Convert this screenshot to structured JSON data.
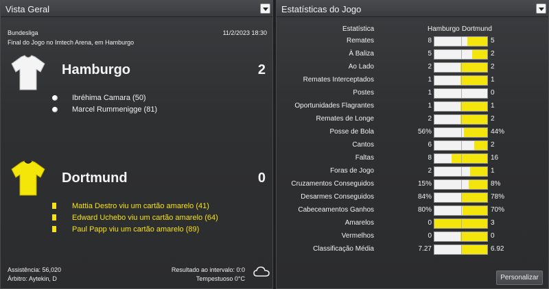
{
  "left_panel": {
    "title": "Vista Geral",
    "competition": "Bundesliga",
    "datetime": "11/2/2023 18:30",
    "venue": "Final do Jogo no Imtech Arena, em Hamburgo",
    "home": {
      "name": "Hamburgo",
      "score": "2",
      "shirt_color": "#f4f4f4",
      "events": [
        {
          "icon": "ball-icon",
          "text": "Ibréhima Camara (50)"
        },
        {
          "icon": "ball-icon",
          "text": "Marcel Rummenigge (81)"
        }
      ]
    },
    "away": {
      "name": "Dortmund",
      "score": "0",
      "shirt_color": "#f5e60a",
      "events": [
        {
          "icon": "yellow-card-icon",
          "text": "Mattia Destro viu um cartão amarelo (41)"
        },
        {
          "icon": "yellow-card-icon",
          "text": "Edward Uchebo viu um cartão amarelo (64)"
        },
        {
          "icon": "yellow-card-icon",
          "text": "Paul Papp viu um cartão amarelo (89)"
        }
      ]
    },
    "attendance": "Assistência: 56,020",
    "referee": "Árbitro: Aytekin, D",
    "halftime": "Resultado ao intervalo: 0:0",
    "weather": "Tempestuoso 0°C",
    "weather_icon": "cloud-icon"
  },
  "right_panel": {
    "title": "Estatísticas do Jogo",
    "header": {
      "stat": "Estatística",
      "home": "Hamburgo",
      "away": "Dortmund"
    },
    "home_color": "#f2f2f2",
    "away_color": "#f4e60c",
    "stats": [
      {
        "label": "Remates",
        "home": "8",
        "away": "5",
        "away_share": 0.38
      },
      {
        "label": "À Baliza",
        "home": "5",
        "away": "2",
        "away_share": 0.29
      },
      {
        "label": "Ao Lado",
        "home": "2",
        "away": "2",
        "away_share": 0.5
      },
      {
        "label": "Remates Interceptados",
        "home": "1",
        "away": "1",
        "away_share": 0.5
      },
      {
        "label": "Postes",
        "home": "1",
        "away": "0",
        "away_share": 0.0
      },
      {
        "label": "Oportunidades Flagrantes",
        "home": "1",
        "away": "1",
        "away_share": 0.5
      },
      {
        "label": "Remates de Longe",
        "home": "2",
        "away": "2",
        "away_share": 0.5
      },
      {
        "label": "Posse de Bola",
        "home": "56%",
        "away": "44%",
        "away_share": 0.44
      },
      {
        "label": "Cantos",
        "home": "6",
        "away": "2",
        "away_share": 0.25
      },
      {
        "label": "Faltas",
        "home": "8",
        "away": "16",
        "away_share": 0.67
      },
      {
        "label": "Foras de Jogo",
        "home": "2",
        "away": "1",
        "away_share": 0.33
      },
      {
        "label": "Cruzamentos Conseguidos",
        "home": "15%",
        "away": "8%",
        "away_share": 0.35
      },
      {
        "label": "Desarmes Conseguidos",
        "home": "84%",
        "away": "78%",
        "away_share": 0.48
      },
      {
        "label": "Cabeceamentos Ganhos",
        "home": "80%",
        "away": "70%",
        "away_share": 0.47
      },
      {
        "label": "Amarelos",
        "home": "0",
        "away": "3",
        "away_share": 1.0
      },
      {
        "label": "Vermelhos",
        "home": "0",
        "away": "0",
        "away_share": 0.5
      },
      {
        "label": "Classificação Média",
        "home": "7.27",
        "away": "6.92",
        "away_share": 0.49
      }
    ],
    "customize_button": "Personalizar"
  }
}
